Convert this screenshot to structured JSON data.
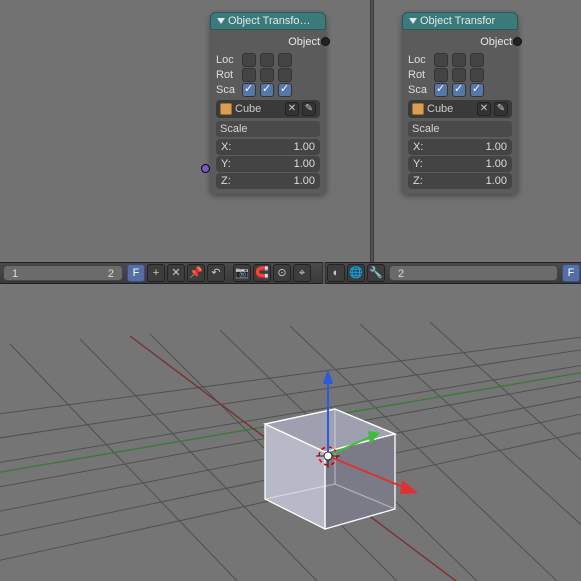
{
  "nodes": {
    "left": {
      "title": "Object Transfo…",
      "output": "Object",
      "rows": [
        {
          "label": "Loc",
          "checks": [
            false,
            false,
            false
          ]
        },
        {
          "label": "Rot",
          "checks": [
            false,
            false,
            false
          ]
        },
        {
          "label": "Sca",
          "checks": [
            true,
            true,
            true
          ]
        }
      ],
      "object_name": "Cube",
      "section": "Scale",
      "scale": {
        "x_label": "X:",
        "x_val": "1.00",
        "y_label": "Y:",
        "y_val": "1.00",
        "z_label": "Z:",
        "z_val": "1.00"
      }
    },
    "right": {
      "title": "Object Transfor",
      "output": "Object",
      "rows": [
        {
          "label": "Loc",
          "checks": [
            false,
            false,
            false
          ]
        },
        {
          "label": "Rot",
          "checks": [
            false,
            false,
            false
          ]
        },
        {
          "label": "Sca",
          "checks": [
            true,
            true,
            true
          ]
        }
      ],
      "object_name": "Cube",
      "section": "Scale",
      "scale": {
        "x_label": "X:",
        "x_val": "1.00",
        "y_label": "Y:",
        "y_val": "1.00",
        "z_label": "Z:",
        "z_val": "1.00"
      }
    }
  },
  "toolbar": {
    "left_num": "1",
    "left_num_right": "2",
    "f_btn": "F",
    "plus_btn": "+",
    "x_btn": "✕",
    "pin_btn": "📌",
    "up_btn": "↶",
    "cam_btn": "📷",
    "mag_btn": "🧲",
    "target_btn": "⊙",
    "snap_btn": "⌖",
    "sep1": "",
    "shade_btn": "◐",
    "globe_btn": "🌐",
    "wrench_btn": "🔧",
    "right_num": "2",
    "f_btn_r": "F"
  }
}
